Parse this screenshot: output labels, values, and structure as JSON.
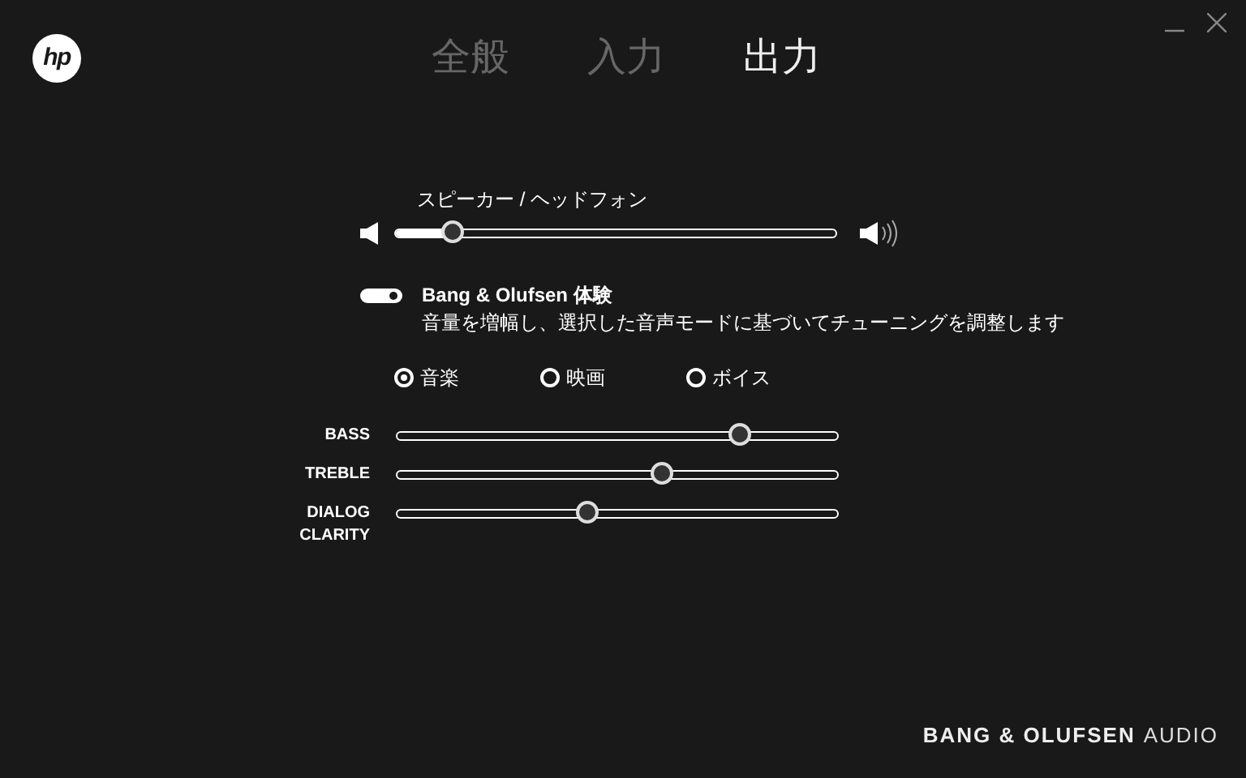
{
  "logo": "hp",
  "tabs": [
    {
      "label": "全般",
      "selected": false
    },
    {
      "label": "入力",
      "selected": false
    },
    {
      "label": "出力",
      "selected": true
    }
  ],
  "volume": {
    "label": "スピーカー / ヘッドフォン",
    "level": 0.13
  },
  "experience": {
    "title": "Bang & Olufsen 体験",
    "on": true,
    "description": "音量を増幅し、選択した音声モードに基づいてチューニングを調整します"
  },
  "modes": [
    {
      "label": "音楽",
      "selected": true
    },
    {
      "label": "映画",
      "selected": false
    },
    {
      "label": "ボイス",
      "selected": false
    }
  ],
  "equalizer": [
    {
      "label": "BASS",
      "level": 0.78
    },
    {
      "label": "TREBLE",
      "level": 0.6
    },
    {
      "label": "DIALOG CLARITY",
      "level": 0.43
    }
  ],
  "brand": {
    "name": "BANG & OLUFSEN",
    "suffix": "AUDIO"
  }
}
